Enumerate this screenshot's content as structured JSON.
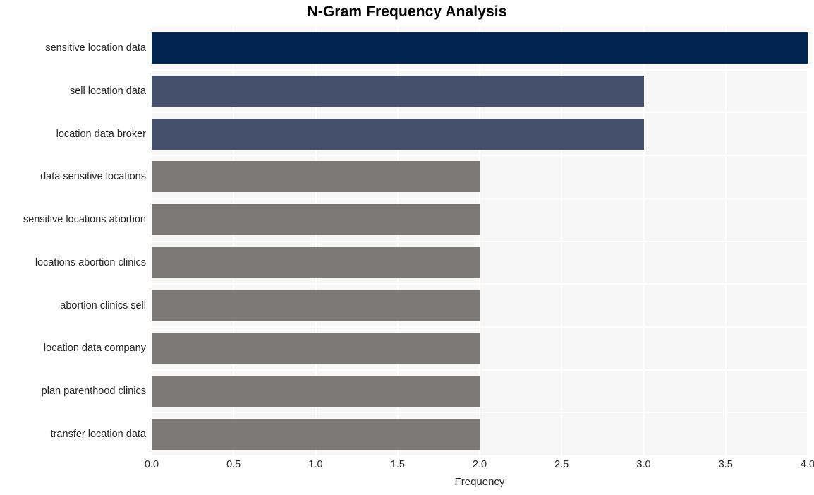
{
  "chart_data": {
    "type": "bar",
    "orientation": "horizontal",
    "title": "N-Gram Frequency Analysis",
    "xlabel": "Frequency",
    "ylabel": "",
    "categories": [
      "sensitive location data",
      "sell location data",
      "location data broker",
      "data sensitive locations",
      "sensitive locations abortion",
      "locations abortion clinics",
      "abortion clinics sell",
      "location data company",
      "plan parenthood clinics",
      "transfer location data"
    ],
    "values": [
      4,
      3,
      3,
      2,
      2,
      2,
      2,
      2,
      2,
      2
    ],
    "bar_colors": [
      "#002350",
      "#45506e",
      "#45506e",
      "#7b7a77",
      "#7b7a77",
      "#7b7a77",
      "#7b7a77",
      "#7b7a77",
      "#7b7a77",
      "#7b7a77"
    ],
    "xlim": [
      0.0,
      4.0
    ],
    "xticks": [
      0.0,
      0.5,
      1.0,
      1.5,
      2.0,
      2.5,
      3.0,
      3.5,
      4.0
    ],
    "xtick_labels": [
      "0.0",
      "0.5",
      "1.0",
      "1.5",
      "2.0",
      "2.5",
      "3.0",
      "3.5",
      "4.0"
    ],
    "grid": true,
    "grid_color": "#ffffff",
    "plot_background": "#f7f7f7",
    "figure_background": "#ffffff",
    "legend": null,
    "title_color": "#000000",
    "tick_label_color": "#262626"
  }
}
